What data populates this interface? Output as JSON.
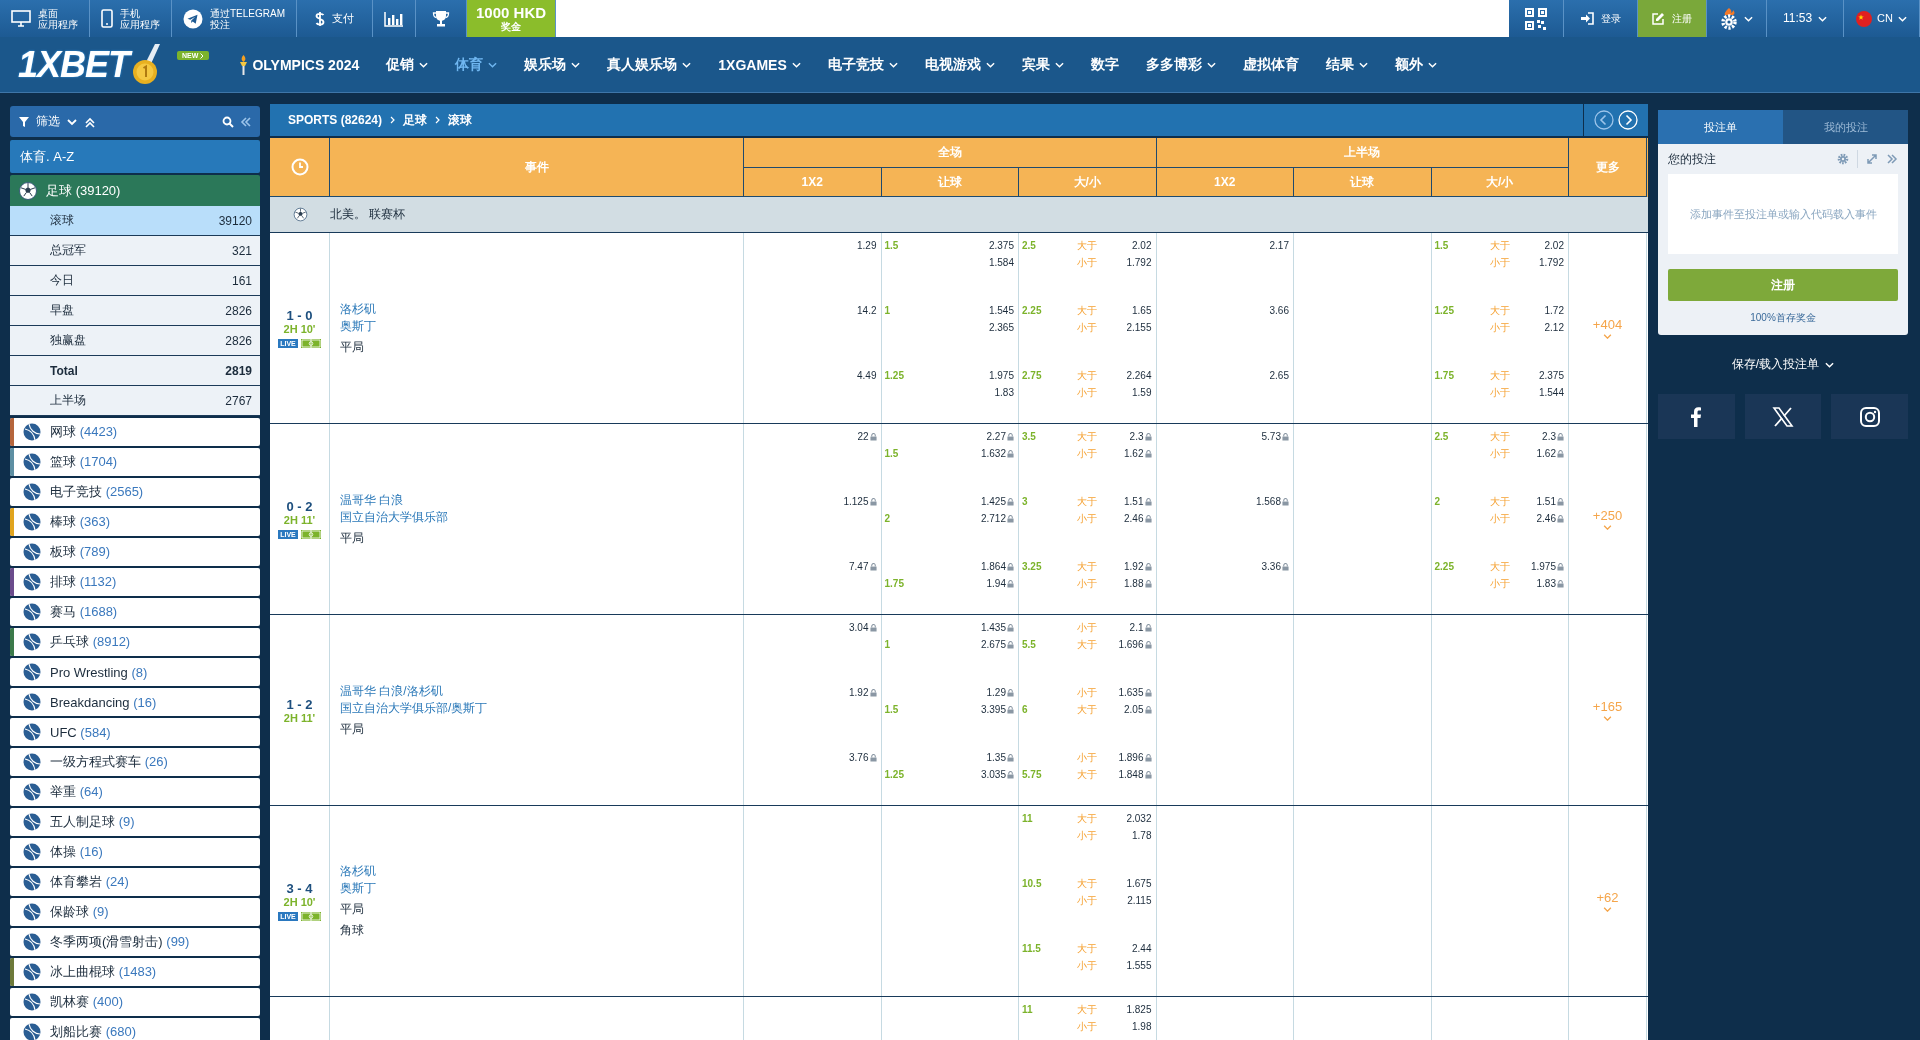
{
  "top_bar": {
    "desktop_app": {
      "lines": [
        "桌面",
        "应用程序"
      ]
    },
    "mobile_app": {
      "lines": [
        "手机",
        "应用程序"
      ]
    },
    "telegram": {
      "lines": [
        "通过TELEGRAM",
        "投注"
      ]
    },
    "payment": {
      "label": "支付"
    },
    "bonus": {
      "amount": "1000 HKD",
      "label": "奖金"
    },
    "login": "登录",
    "register": "注册",
    "time": "11:53",
    "language": "CN"
  },
  "nav": {
    "logo": "1XBET",
    "badge": "NEW",
    "olympics": "OLYMPICS 2024",
    "items": [
      {
        "label": "促销",
        "dropdown": true,
        "selected": false
      },
      {
        "label": "体育",
        "dropdown": true,
        "selected": true
      },
      {
        "label": "娱乐场",
        "dropdown": true,
        "selected": false
      },
      {
        "label": "真人娱乐场",
        "dropdown": true,
        "selected": false
      },
      {
        "label": "1XGAMES",
        "dropdown": true,
        "selected": false
      },
      {
        "label": "电子竞技",
        "dropdown": true,
        "selected": false
      },
      {
        "label": "电视游戏",
        "dropdown": true,
        "selected": false
      },
      {
        "label": "宾果",
        "dropdown": true,
        "selected": false
      },
      {
        "label": "数字",
        "dropdown": false,
        "selected": false
      },
      {
        "label": "多多博彩",
        "dropdown": true,
        "selected": false
      },
      {
        "label": "虚拟体育",
        "dropdown": false,
        "selected": false
      },
      {
        "label": "结果",
        "dropdown": true,
        "selected": false
      },
      {
        "label": "额外",
        "dropdown": true,
        "selected": false
      }
    ]
  },
  "sidebar": {
    "filter_label": "筛选",
    "az_label": "体育. A-Z",
    "current_sport": {
      "name": "足球",
      "count": "(39120)",
      "subitems": [
        {
          "label": "滚球",
          "count": "39120",
          "selected": true,
          "bold": false
        },
        {
          "label": "总冠军",
          "count": "321",
          "selected": false,
          "bold": false
        },
        {
          "label": "今日",
          "count": "161",
          "selected": false,
          "bold": false
        },
        {
          "label": "早盘",
          "count": "2826",
          "selected": false,
          "bold": false
        },
        {
          "label": "独赢盘",
          "count": "2826",
          "selected": false,
          "bold": false
        },
        {
          "label": "Total",
          "count": "2819",
          "selected": false,
          "bold": true
        },
        {
          "label": "上半场",
          "count": "2767",
          "selected": false,
          "bold": false
        }
      ]
    },
    "sports": [
      {
        "name": "网球",
        "count": "(4423)",
        "color": "#b5653c"
      },
      {
        "name": "篮球",
        "count": "(1704)",
        "color": "#5d8fa3"
      },
      {
        "name": "电子竞技",
        "count": "(2565)"
      },
      {
        "name": "棒球",
        "count": "(363)",
        "color": "#e0a41e"
      },
      {
        "name": "板球",
        "count": "(789)"
      },
      {
        "name": "排球",
        "count": "(1132)",
        "color": "#6b4c8c"
      },
      {
        "name": "赛马",
        "count": "(1688)"
      },
      {
        "name": "乒乓球",
        "count": "(8912)",
        "color": "#3b7a4a"
      },
      {
        "name": "Pro Wrestling",
        "count": "(8)"
      },
      {
        "name": "Breakdancing",
        "count": "(16)"
      },
      {
        "name": "UFC",
        "count": "(584)"
      },
      {
        "name": "一级方程式赛车",
        "count": "(26)"
      },
      {
        "name": "举重",
        "count": "(64)"
      },
      {
        "name": "五人制足球",
        "count": "(9)"
      },
      {
        "name": "体操",
        "count": "(16)"
      },
      {
        "name": "体育攀岩",
        "count": "(24)"
      },
      {
        "name": "保龄球",
        "count": "(9)"
      },
      {
        "name": "冬季两项(滑雪射击)",
        "count": "(99)"
      },
      {
        "name": "冰上曲棍球",
        "count": "(1483)",
        "color": "#6d7a3a"
      },
      {
        "name": "凯林赛",
        "count": "(400)"
      },
      {
        "name": "划船比赛",
        "count": "(680)"
      }
    ]
  },
  "main": {
    "breadcrumb": [
      "SPORTS (82624)",
      "足球",
      "滚球"
    ],
    "table": {
      "event_header": "事件",
      "groups": [
        "全场",
        "上半场"
      ],
      "columns": [
        "1X2",
        "让球",
        "大/小",
        "1X2",
        "让球",
        "大/小"
      ],
      "more_header": "更多",
      "league": "北美。 联赛杯",
      "matches": [
        {
          "score": "1 - 0",
          "time": "2H 10'",
          "live_label": "LIVE",
          "locked": false,
          "teams": [
            "洛杉矶",
            "奥斯丁"
          ],
          "extras": [
            "平局"
          ],
          "more": "+404",
          "lines": [
            {
              "ft_1x2": {
                "odds": "1.29"
              },
              "ft_handicap": {
                "line": "1.5",
                "odds": "2.375"
              },
              "ft_total": {
                "line": "2.5",
                "label": "大于",
                "odds": "2.02"
              },
              "ht_1x2": {
                "odds": "2.17"
              },
              "ht_total": {
                "line": "1.5",
                "label": "大于",
                "odds": "2.02"
              }
            },
            {
              "ft_handicap": {
                "odds": "1.584"
              },
              "ft_total": {
                "label": "小于",
                "odds": "1.792"
              },
              "ht_total": {
                "label": "小于",
                "odds": "1.792"
              }
            },
            {
              "ft_1x2": {
                "odds": "14.2"
              },
              "ft_handicap": {
                "line": "1",
                "odds": "1.545"
              },
              "ft_total": {
                "line": "2.25",
                "label": "大于",
                "odds": "1.65"
              },
              "ht_1x2": {
                "odds": "3.66"
              },
              "ht_total": {
                "line": "1.25",
                "label": "大于",
                "odds": "1.72"
              }
            },
            {
              "ft_handicap": {
                "odds": "2.365"
              },
              "ft_total": {
                "label": "小于",
                "odds": "2.155"
              },
              "ht_total": {
                "label": "小于",
                "odds": "2.12"
              }
            },
            {
              "ft_1x2": {
                "odds": "4.49"
              },
              "ft_handicap": {
                "line": "1.25",
                "odds": "1.975"
              },
              "ft_total": {
                "line": "2.75",
                "label": "大于",
                "odds": "2.264"
              },
              "ht_1x2": {
                "odds": "2.65"
              },
              "ht_total": {
                "line": "1.75",
                "label": "大于",
                "odds": "2.375"
              }
            },
            {
              "ft_handicap": {
                "odds": "1.83"
              },
              "ft_total": {
                "label": "小于",
                "odds": "1.59"
              },
              "ht_total": {
                "label": "小于",
                "odds": "1.544"
              }
            }
          ]
        },
        {
          "score": "0 - 2",
          "time": "2H 11'",
          "live_label": "LIVE",
          "locked": true,
          "teams": [
            "温哥华 白浪",
            "国立自治大学俱乐部"
          ],
          "extras": [
            "平局"
          ],
          "more": "+250",
          "lines": [
            {
              "ft_1x2": {
                "odds": "22"
              },
              "ft_handicap": {
                "odds": "2.27"
              },
              "ft_total": {
                "line": "3.5",
                "label": "大于",
                "odds": "2.3"
              },
              "ht_1x2": {
                "odds": "5.73"
              },
              "ht_total": {
                "line": "2.5",
                "label": "大于",
                "odds": "2.3"
              }
            },
            {
              "ft_handicap": {
                "line": "1.5",
                "odds": "1.632"
              },
              "ft_total": {
                "label": "小于",
                "odds": "1.62"
              },
              "ht_total": {
                "label": "小于",
                "odds": "1.62"
              }
            },
            {
              "ft_1x2": {
                "odds": "1.125"
              },
              "ft_handicap": {
                "odds": "1.425"
              },
              "ft_total": {
                "line": "3",
                "label": "大于",
                "odds": "1.51"
              },
              "ht_1x2": {
                "odds": "1.568"
              },
              "ht_total": {
                "line": "2",
                "label": "大于",
                "odds": "1.51"
              }
            },
            {
              "ft_handicap": {
                "line": "2",
                "odds": "2.712"
              },
              "ft_total": {
                "label": "小于",
                "odds": "2.46"
              },
              "ht_total": {
                "label": "小于",
                "odds": "2.46"
              }
            },
            {
              "ft_1x2": {
                "odds": "7.47"
              },
              "ft_handicap": {
                "odds": "1.864"
              },
              "ft_total": {
                "line": "3.25",
                "label": "大于",
                "odds": "1.92"
              },
              "ht_1x2": {
                "odds": "3.36"
              },
              "ht_total": {
                "line": "2.25",
                "label": "大于",
                "odds": "1.975"
              }
            },
            {
              "ft_handicap": {
                "line": "1.75",
                "odds": "1.94"
              },
              "ft_total": {
                "label": "小于",
                "odds": "1.88"
              },
              "ht_total": {
                "label": "小于",
                "odds": "1.83"
              }
            }
          ]
        },
        {
          "score": "1 - 2",
          "time": "2H 11'",
          "locked": true,
          "teams": [
            "温哥华 白浪/洛杉矶",
            "国立自治大学俱乐部/奥斯丁"
          ],
          "extras": [
            "平局"
          ],
          "more": "+165",
          "lines": [
            {
              "ft_1x2": {
                "odds": "3.04"
              },
              "ft_handicap": {
                "odds": "1.435"
              },
              "ft_total": {
                "label": "小于",
                "odds": "2.1"
              }
            },
            {
              "ft_handicap": {
                "line": "1",
                "odds": "2.675"
              },
              "ft_total": {
                "line": "5.5",
                "label": "大于",
                "odds": "1.696"
              }
            },
            {
              "ft_1x2": {
                "odds": "1.92"
              },
              "ft_handicap": {
                "odds": "1.29"
              },
              "ft_total": {
                "label": "小于",
                "odds": "1.635"
              }
            },
            {
              "ft_handicap": {
                "line": "1.5",
                "odds": "3.395"
              },
              "ft_total": {
                "line": "6",
                "label": "大于",
                "odds": "2.05"
              }
            },
            {
              "ft_1x2": {
                "odds": "3.76"
              },
              "ft_handicap": {
                "odds": "1.35"
              },
              "ft_total": {
                "label": "小于",
                "odds": "1.896"
              }
            },
            {
              "ft_handicap": {
                "line": "1.25",
                "odds": "3.035"
              },
              "ft_total": {
                "line": "5.75",
                "label": "大于",
                "odds": "1.848"
              }
            }
          ]
        },
        {
          "score": "3 - 4",
          "time": "2H 10'",
          "live_label": "LIVE",
          "locked": false,
          "teams": [
            "洛杉矶",
            "奥斯丁"
          ],
          "extras": [
            "平局",
            "角球"
          ],
          "more": "+62",
          "lines": [
            {
              "ft_total": {
                "line": "11",
                "label": "大于",
                "odds": "2.032"
              }
            },
            {
              "ft_total": {
                "label": "小于",
                "odds": "1.78"
              }
            },
            {
              "ft_total": {
                "line": "10.5",
                "label": "大于",
                "odds": "1.675"
              }
            },
            {
              "ft_total": {
                "label": "小于",
                "odds": "2.115"
              }
            },
            {
              "ft_total": {
                "line": "11.5",
                "label": "大于",
                "odds": "2.44"
              }
            },
            {
              "ft_total": {
                "label": "小于",
                "odds": "1.555"
              }
            }
          ]
        },
        {
          "locked": false,
          "lines": [
            {
              "ft_total": {
                "line": "11",
                "label": "大于",
                "odds": "1.825"
              }
            },
            {
              "ft_total": {
                "label": "小于",
                "odds": "1.98"
              }
            }
          ]
        }
      ]
    }
  },
  "betslip": {
    "tabs": [
      {
        "label": "投注单",
        "selected": true
      },
      {
        "label": "我的投注",
        "selected": false
      }
    ],
    "title": "您的投注",
    "empty_text": "添加事件至投注单或输入代码载入事件",
    "register": "注册",
    "bonus_link": "100%首存奖金",
    "save_load": "保存/载入投注单"
  }
}
